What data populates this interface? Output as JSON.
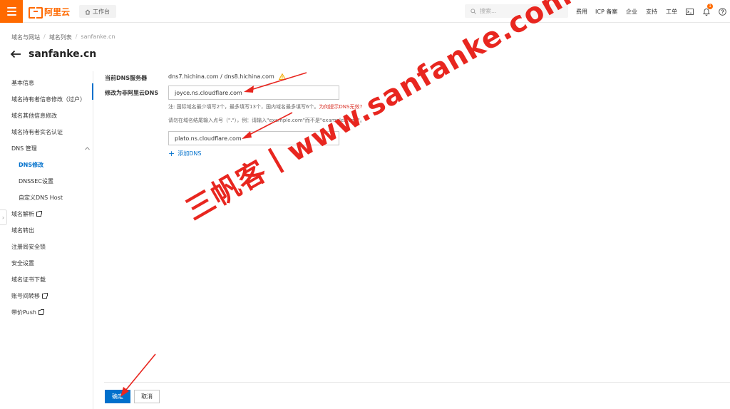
{
  "topbar": {
    "brand": "阿里云",
    "workbench": "工作台",
    "search_placeholder": "搜索...",
    "nav": [
      "费用",
      "ICP 备案",
      "企业",
      "支持",
      "工单"
    ],
    "notification_count": "1",
    "accent": "#ff6a00"
  },
  "breadcrumb": [
    "域名与网站",
    "域名列表",
    "sanfanke.cn"
  ],
  "page_title": "sanfanke.cn",
  "sidebar": {
    "items": [
      {
        "label": "基本信息"
      },
      {
        "label": "域名持有者信息修改（过户）"
      },
      {
        "label": "域名其他信息修改"
      },
      {
        "label": "域名持有者实名认证"
      },
      {
        "label": "DNS 管理",
        "expanded": true
      },
      {
        "label": "DNS修改",
        "active": true
      },
      {
        "label": "DNSSEC设置"
      },
      {
        "label": "自定义DNS Host"
      },
      {
        "label": "域名解析",
        "external": true
      },
      {
        "label": "域名转出"
      },
      {
        "label": "注册局安全锁"
      },
      {
        "label": "安全设置"
      },
      {
        "label": "域名证书下载"
      },
      {
        "label": "账号间转移",
        "external": true
      },
      {
        "label": "带价Push",
        "external": true
      }
    ]
  },
  "form": {
    "current_dns_label": "当前DNS服务器",
    "current_dns_value": "dns7.hichina.com / dns8.hichina.com",
    "modify_label": "修改为非阿里云DNS",
    "dns1_value": "joyce.ns.cloudflare.com",
    "note1": "注:   国际域名最少填写2个，最多填写13个，国内域名最多填写6个。",
    "note1_link": "为何提示DNS无效?",
    "note2": "请勿在域名结尾输入点号（\".\"），例：请输入\"example.com\"而不是\"example.com.\"。",
    "dns2_value": "plato.ns.cloudflare.com",
    "add_dns": "添加DNS"
  },
  "footer": {
    "confirm": "确定",
    "cancel": "取消"
  },
  "watermark": "三帆客丨www.sanfanke.com",
  "colors": {
    "primary": "#0070cc",
    "watermark": "#e8261f",
    "link_red": "#d93026"
  }
}
